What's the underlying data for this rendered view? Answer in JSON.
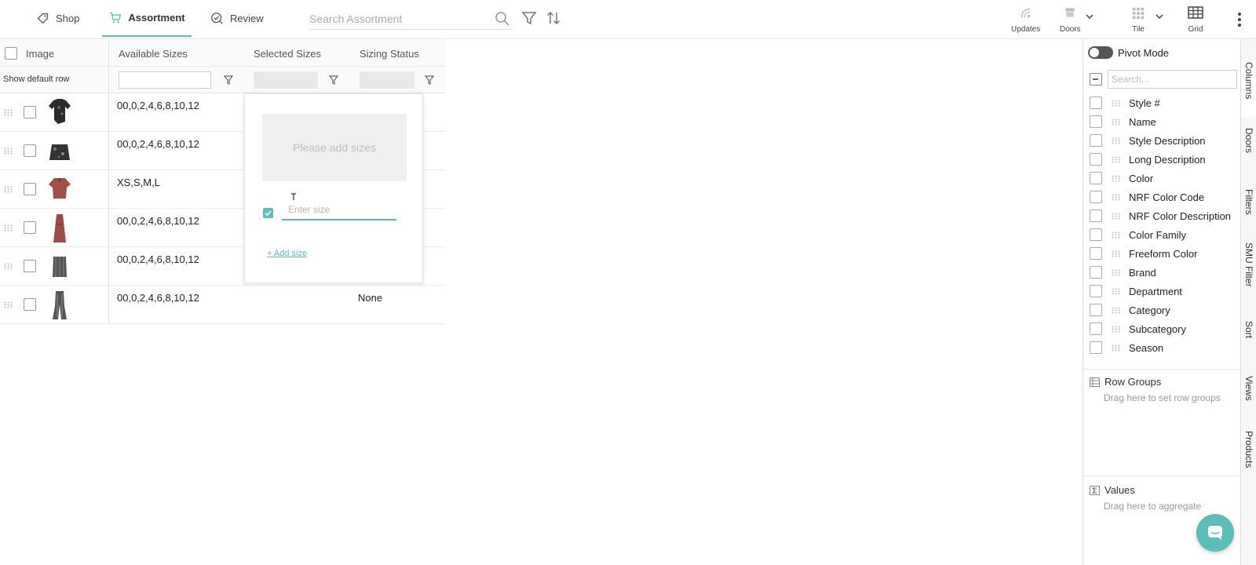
{
  "nav": {
    "tabs": [
      {
        "label": "Shop",
        "icon": "tag-icon"
      },
      {
        "label": "Assortment",
        "icon": "cart-icon"
      },
      {
        "label": "Review",
        "icon": "review-icon"
      }
    ],
    "search_placeholder": "Search Assortment",
    "right_icons": {
      "updates": "Updates",
      "doors": "Doors",
      "tile": "Tile",
      "grid": "Grid"
    }
  },
  "grid": {
    "headers": {
      "image": "Image",
      "available_sizes": "Available Sizes",
      "selected_sizes": "Selected Sizes",
      "sizing_status": "Sizing Status"
    },
    "show_default_row": "Show default row",
    "rows": [
      {
        "available_sizes": "00,0,2,4,6,8,10,12",
        "sizing_status": ""
      },
      {
        "available_sizes": "00,0,2,4,6,8,10,12",
        "sizing_status": ""
      },
      {
        "available_sizes": "XS,S,M,L",
        "sizing_status": ""
      },
      {
        "available_sizes": "00,0,2,4,6,8,10,12",
        "sizing_status": ""
      },
      {
        "available_sizes": "00,0,2,4,6,8,10,12",
        "sizing_status": ""
      },
      {
        "available_sizes": "00,0,2,4,6,8,10,12",
        "sizing_status": "None"
      }
    ]
  },
  "size_popup": {
    "empty_text": "Please add sizes",
    "enter_placeholder": "Enter size",
    "add_link": "+ Add size"
  },
  "side_panel": {
    "pivot_mode": "Pivot Mode",
    "search_placeholder": "Search...",
    "columns": [
      "Style #",
      "Name",
      "Style Description",
      "Long Description",
      "Color",
      "NRF Color Code",
      "NRF Color Description",
      "Color Family",
      "Freeform Color",
      "Brand",
      "Department",
      "Category",
      "Subcategory",
      "Season"
    ],
    "row_groups": {
      "title": "Row Groups",
      "hint": "Drag here to set row groups"
    },
    "values": {
      "title": "Values",
      "hint": "Drag here to aggregate"
    }
  },
  "vertical_tabs": [
    "Columns",
    "Doors",
    "Filters",
    "SMU Filter",
    "Sort",
    "Views",
    "Products"
  ],
  "colors": {
    "accent": "#5cbdb9"
  }
}
